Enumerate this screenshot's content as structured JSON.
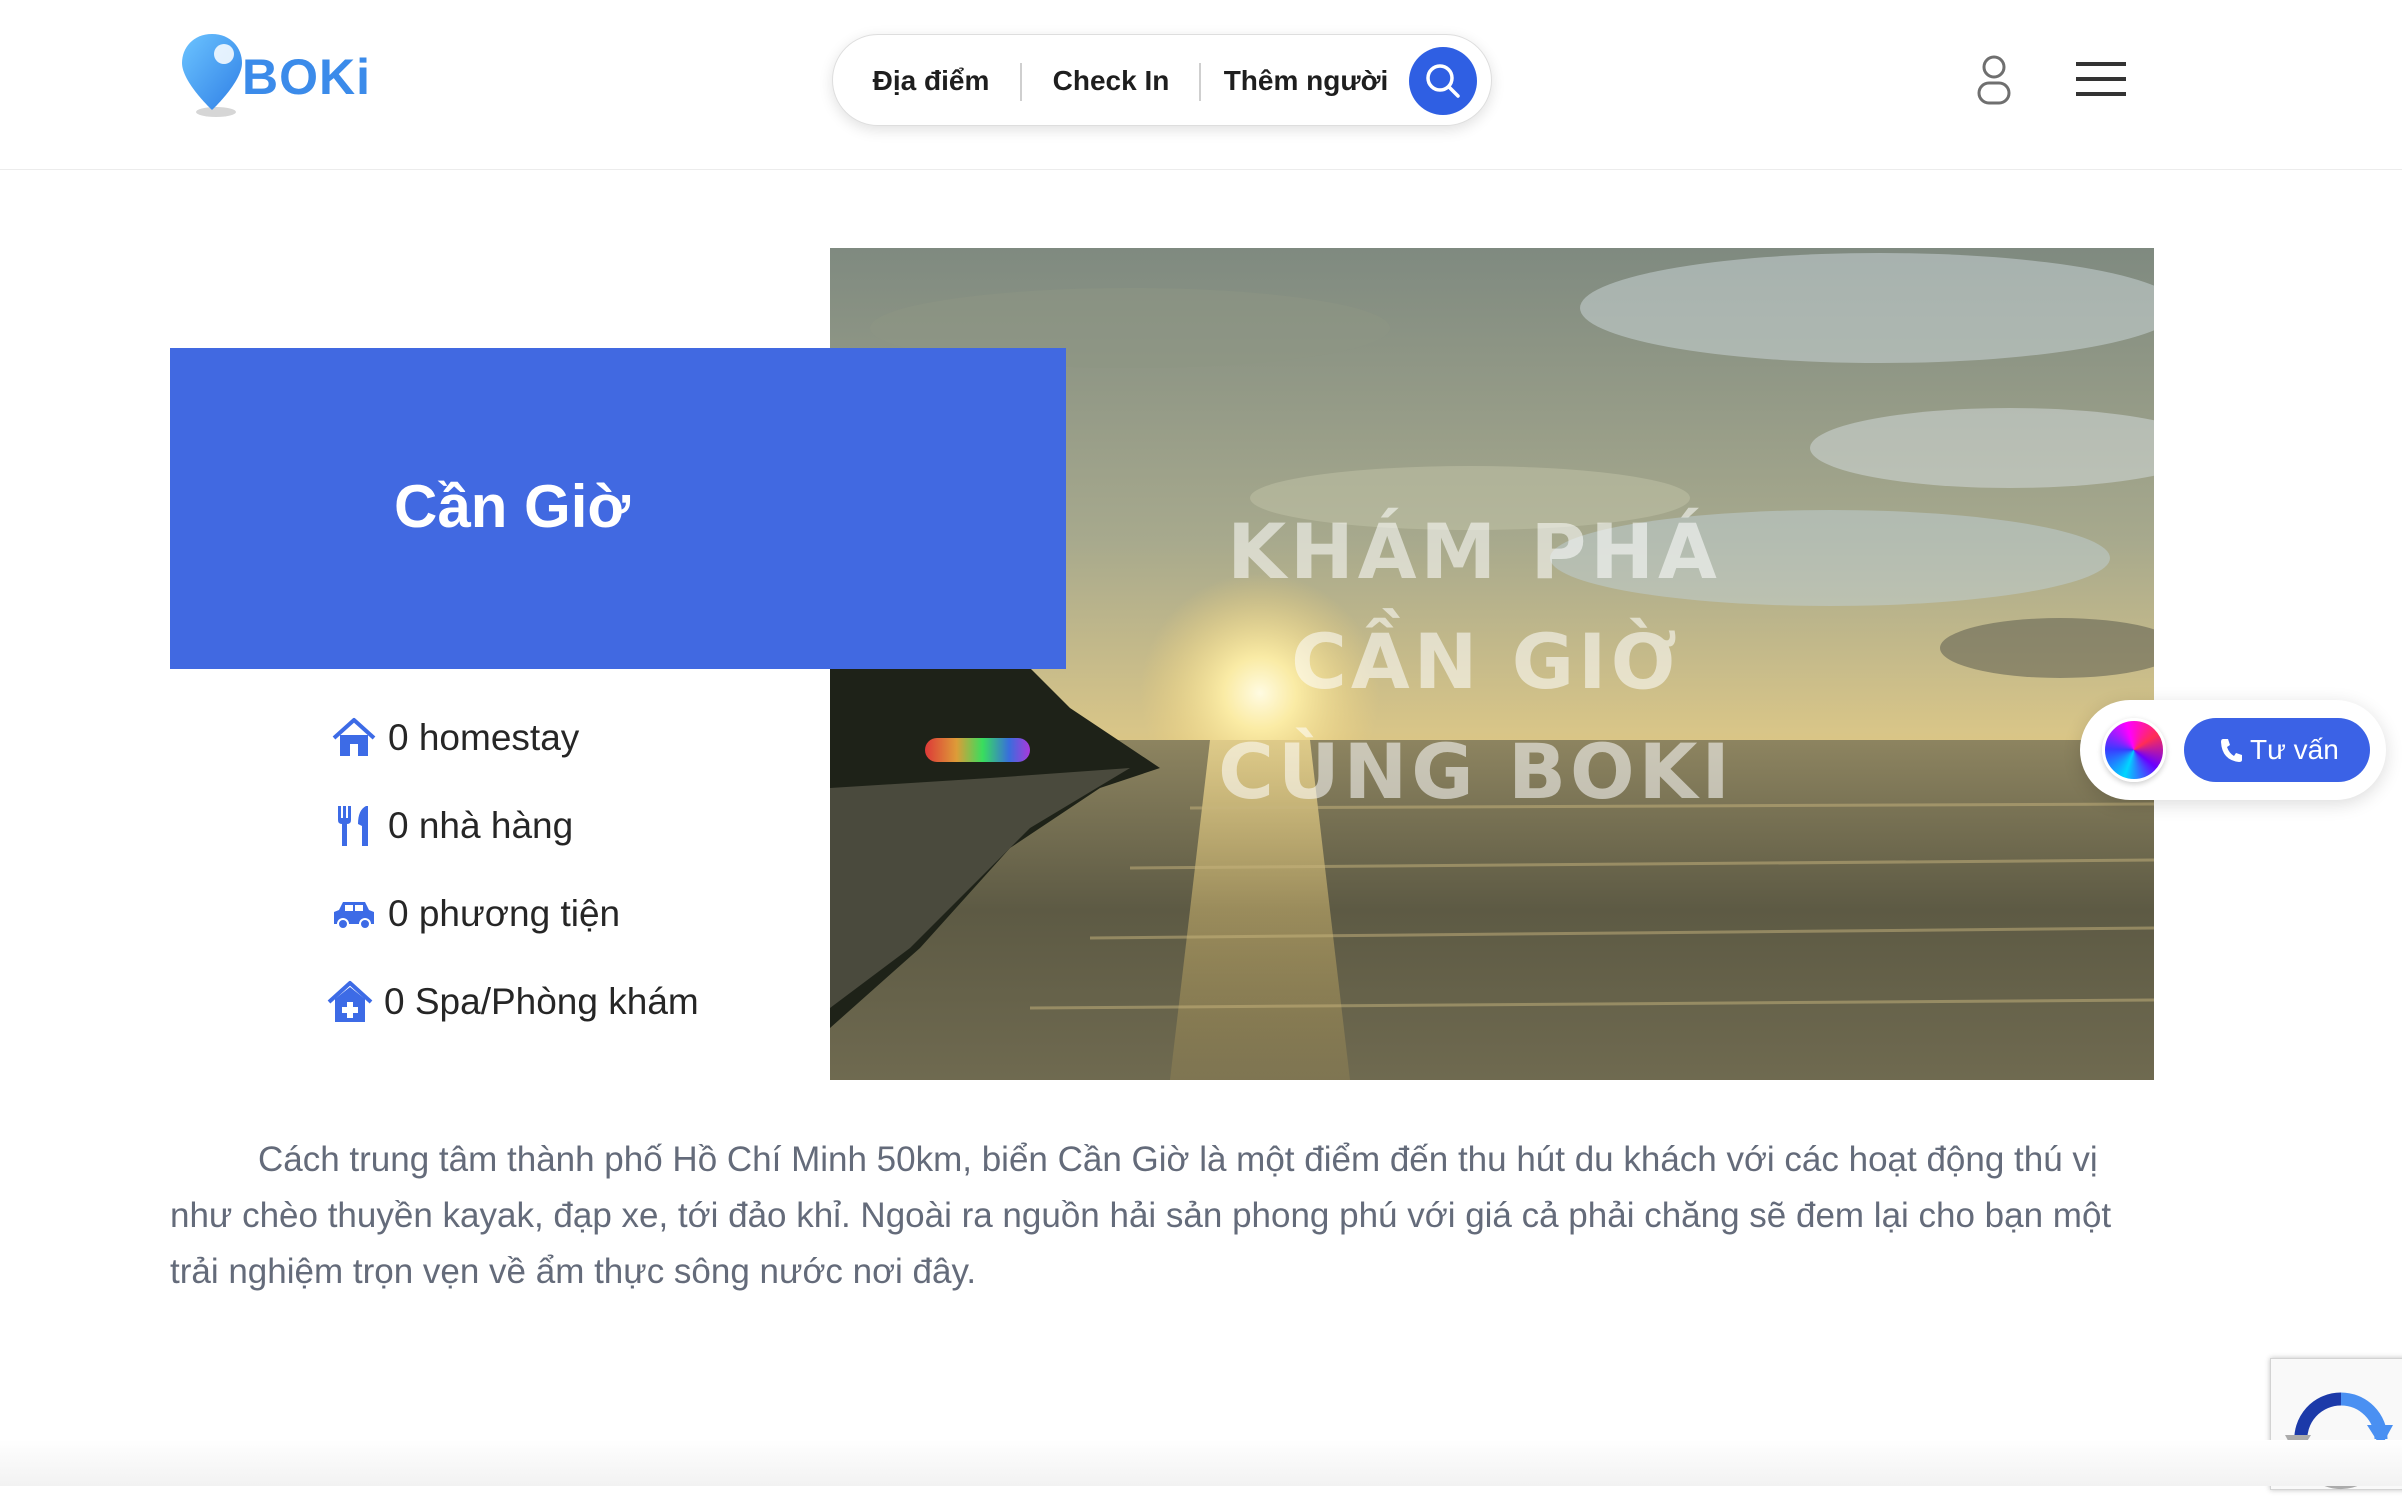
{
  "brand": {
    "name": "BOKi",
    "accent": "#4169e1"
  },
  "search": {
    "location_label": "Địa điểm",
    "checkin_label": "Check In",
    "guests_label": "Thêm người"
  },
  "hero": {
    "title": "Cần Giờ",
    "overlay_lines": [
      "KHÁM PHÁ",
      "CẦN GIỜ",
      "CÙNG BOKI"
    ],
    "stats": [
      {
        "icon": "home-icon",
        "label": "0 homestay"
      },
      {
        "icon": "restaurant-icon",
        "label": "0 nhà hàng"
      },
      {
        "icon": "car-icon",
        "label": "0 phương tiện"
      },
      {
        "icon": "clinic-icon",
        "label": "0 Spa/Phòng khám"
      }
    ]
  },
  "description": "Cách trung tâm thành phố Hồ Chí Minh 50km, biển Cần Giờ là một điểm đến thu hút du khách với các hoạt động thú vị như chèo thuyền kayak, đạp xe, tới đảo khỉ. Ngoài ra nguồn hải sản phong phú với giá cả phải chăng sẽ đem lại cho bạn một trải nghiệm trọn vẹn về ẩm thực sông nước nơi đây.",
  "consult": {
    "label": "Tư vấn"
  }
}
